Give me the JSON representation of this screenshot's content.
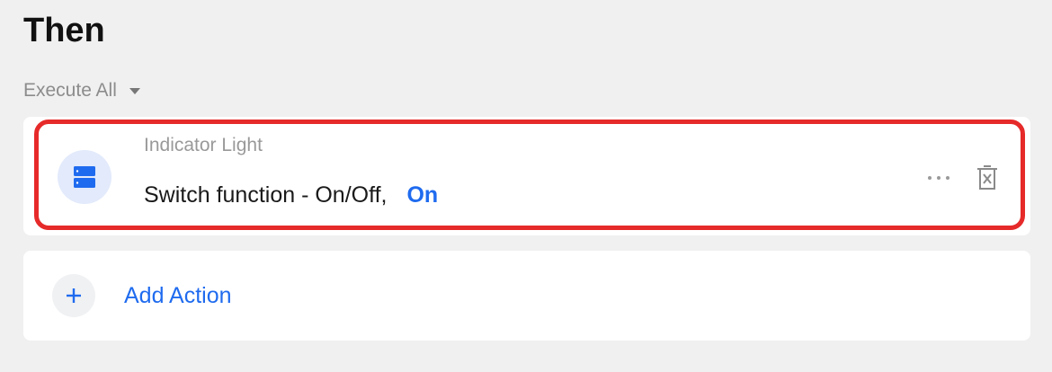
{
  "section": {
    "title": "Then",
    "execution_mode": "Execute All"
  },
  "action": {
    "device_name": "Indicator Light",
    "function_text": "Switch function - On/Off,",
    "value": "On",
    "icon": "server-stack-icon"
  },
  "add_action": {
    "label": "Add Action",
    "icon": "plus-icon"
  },
  "colors": {
    "accent": "#1f6bef",
    "highlight": "#e62a2a",
    "background": "#f0f0f0"
  }
}
